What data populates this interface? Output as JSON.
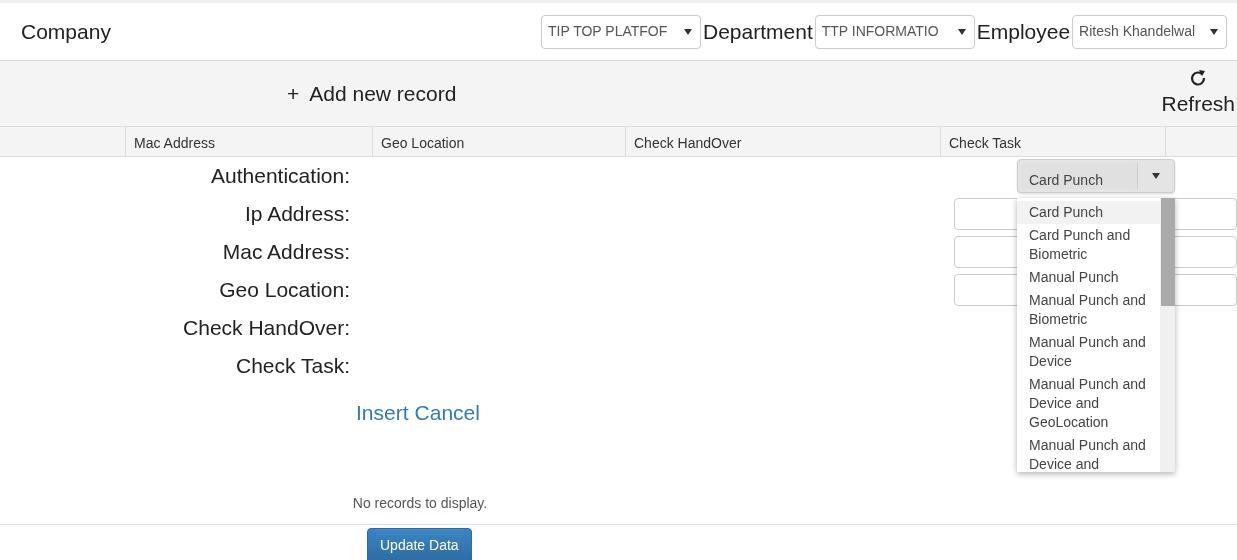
{
  "filters": [
    {
      "label": "Company",
      "value": "TIP TOP PLATFOF"
    },
    {
      "label": "Department",
      "value": "TTP INFORMATIO"
    },
    {
      "label": "Employee",
      "value": "Ritesh Khandelwal"
    }
  ],
  "toolbar": {
    "add_label": "Add new record",
    "add_icon": "+",
    "refresh_label": "Refresh"
  },
  "table": {
    "columns": [
      "",
      "Mac Address",
      "Geo Location",
      "Check HandOver",
      "Check Task",
      ""
    ]
  },
  "form": {
    "rows": [
      {
        "label": "Authentication:",
        "kind": "select",
        "value": "Card Punch"
      },
      {
        "label": "Ip Address:",
        "kind": "input"
      },
      {
        "label": "Mac Address:",
        "kind": "input"
      },
      {
        "label": "Geo Location:",
        "kind": "input"
      },
      {
        "label": "Check HandOver:",
        "kind": "none"
      },
      {
        "label": "Check Task:",
        "kind": "none"
      }
    ],
    "actions": [
      "Insert",
      "Cancel"
    ]
  },
  "dropdown": {
    "options": [
      {
        "label": "Card Punch",
        "selected": true
      },
      {
        "label": "Card Punch and Biometric",
        "selected": false
      },
      {
        "label": "Manual Punch",
        "selected": false
      },
      {
        "label": "Manual Punch and Biometric",
        "selected": false
      },
      {
        "label": "Manual Punch and Device",
        "selected": false
      },
      {
        "label": "Manual Punch and Device and GeoLocation",
        "selected": false
      },
      {
        "label": "Manual Punch and Device and",
        "selected": false
      }
    ]
  },
  "empty_message": "No records to display.",
  "footer": {
    "button": "Update Data"
  }
}
